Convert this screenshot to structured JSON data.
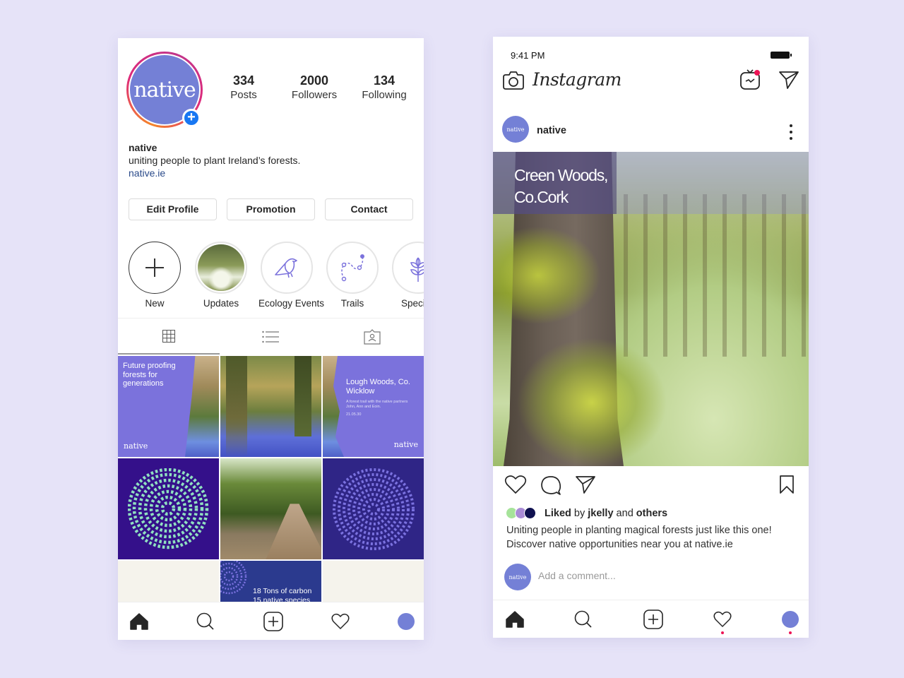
{
  "colors": {
    "background": "#e6e3f8",
    "brand_purple": "#7b72dc",
    "avatar_blue": "#7480d6",
    "link_blue": "#2a4a8a",
    "add_badge": "#1877f2",
    "notification": "#ed1455"
  },
  "profile": {
    "avatar_text": "native",
    "stats": [
      {
        "value": "334",
        "label": "Posts"
      },
      {
        "value": "2000",
        "label": "Followers"
      },
      {
        "value": "134",
        "label": "Following"
      }
    ],
    "name": "native",
    "bio": "uniting people to plant Ireland’s forests.",
    "link": "native.ie",
    "buttons": [
      "Edit Profile",
      "Promotion",
      "Contact"
    ],
    "highlights": [
      {
        "label": "New",
        "icon": "plus-icon"
      },
      {
        "label": "Updates",
        "icon": "photo"
      },
      {
        "label": "Ecology Events",
        "icon": "bird-icon"
      },
      {
        "label": "Trails",
        "icon": "trail-icon"
      },
      {
        "label": "Species",
        "icon": "leaf-icon"
      }
    ],
    "tabs": [
      {
        "name": "grid-icon",
        "active": true
      },
      {
        "name": "list-icon",
        "active": false
      },
      {
        "name": "tagged-icon",
        "active": false
      }
    ],
    "grid": {
      "post1": {
        "text": "Future proofing forests for generations",
        "brand": "native"
      },
      "post3": {
        "title": "Lough Woods, Co. Wicklow",
        "desc": "A forest trail with the native partners John, Ann and Eoin.",
        "date": "21.05.30",
        "brand": "native"
      },
      "post8": {
        "line1": "18 Tons of carbon",
        "line2": "15 native species"
      }
    }
  },
  "feed": {
    "status_time": "9:41 PM",
    "app_name": "Instagram",
    "post": {
      "username": "native",
      "avatar_text": "native",
      "image_title_line1": "Creen Woods,",
      "image_title_line2": "Co.Cork",
      "liked_prefix": "Liked",
      "liked_by_word": " by ",
      "liked_user": "jkelly",
      "liked_and": " and ",
      "liked_others": "others",
      "liker_colors": [
        "#a6e39a",
        "#a98bd6",
        "#0f1150"
      ],
      "caption_line1": "Uniting people in planting magical forests just like this one!",
      "caption_line2": "Discover native opportunities near you at native.ie",
      "comment_placeholder": "Add a comment..."
    }
  }
}
